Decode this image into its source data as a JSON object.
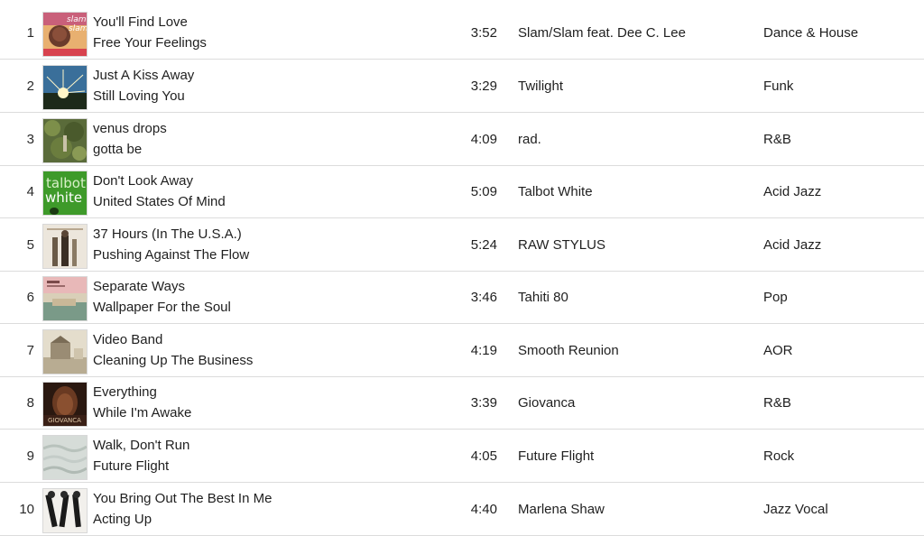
{
  "tracks": [
    {
      "number": "1",
      "title": "You'll Find Love",
      "album": "Free Your Feelings",
      "time": "3:52",
      "artist": "Slam/Slam feat. Dee C. Lee",
      "genre": "Dance & House",
      "artwork_icon": "album-artwork-icon"
    },
    {
      "number": "2",
      "title": "Just A Kiss Away",
      "album": "Still Loving You",
      "time": "3:29",
      "artist": "Twilight",
      "genre": "Funk",
      "artwork_icon": "album-artwork-icon"
    },
    {
      "number": "3",
      "title": "venus drops",
      "album": "gotta be",
      "time": "4:09",
      "artist": "rad.",
      "genre": "R&B",
      "artwork_icon": "album-artwork-icon"
    },
    {
      "number": "4",
      "title": "Don't Look Away",
      "album": "United States Of Mind",
      "time": "5:09",
      "artist": "Talbot White",
      "genre": "Acid Jazz",
      "artwork_icon": "album-artwork-icon"
    },
    {
      "number": "5",
      "title": "37 Hours (In The U.S.A.)",
      "album": "Pushing Against The Flow",
      "time": "5:24",
      "artist": "RAW STYLUS",
      "genre": "Acid Jazz",
      "artwork_icon": "album-artwork-icon"
    },
    {
      "number": "6",
      "title": "Separate Ways",
      "album": "Wallpaper For the Soul",
      "time": "3:46",
      "artist": "Tahiti 80",
      "genre": "Pop",
      "artwork_icon": "album-artwork-icon"
    },
    {
      "number": "7",
      "title": "Video Band",
      "album": "Cleaning Up The Business",
      "time": "4:19",
      "artist": "Smooth Reunion",
      "genre": "AOR",
      "artwork_icon": "album-artwork-icon"
    },
    {
      "number": "8",
      "title": "Everything",
      "album": "While I'm Awake",
      "time": "3:39",
      "artist": "Giovanca",
      "genre": "R&B",
      "artwork_icon": "album-artwork-icon"
    },
    {
      "number": "9",
      "title": "Walk, Don't Run",
      "album": "Future Flight",
      "time": "4:05",
      "artist": "Future Flight",
      "genre": "Rock",
      "artwork_icon": "album-artwork-icon"
    },
    {
      "number": "10",
      "title": "You Bring Out The Best In Me",
      "album": "Acting Up",
      "time": "4:40",
      "artist": "Marlena Shaw",
      "genre": "Jazz Vocal",
      "artwork_icon": "album-artwork-icon"
    }
  ],
  "artwork_logos": {
    "slam": "slam",
    "talbot": "talbot",
    "white": "white",
    "giovanca": "GIOVANCA"
  },
  "colors": {
    "text": "#1f1f1f",
    "divider": "#dcdcdc",
    "background": "#ffffff"
  }
}
